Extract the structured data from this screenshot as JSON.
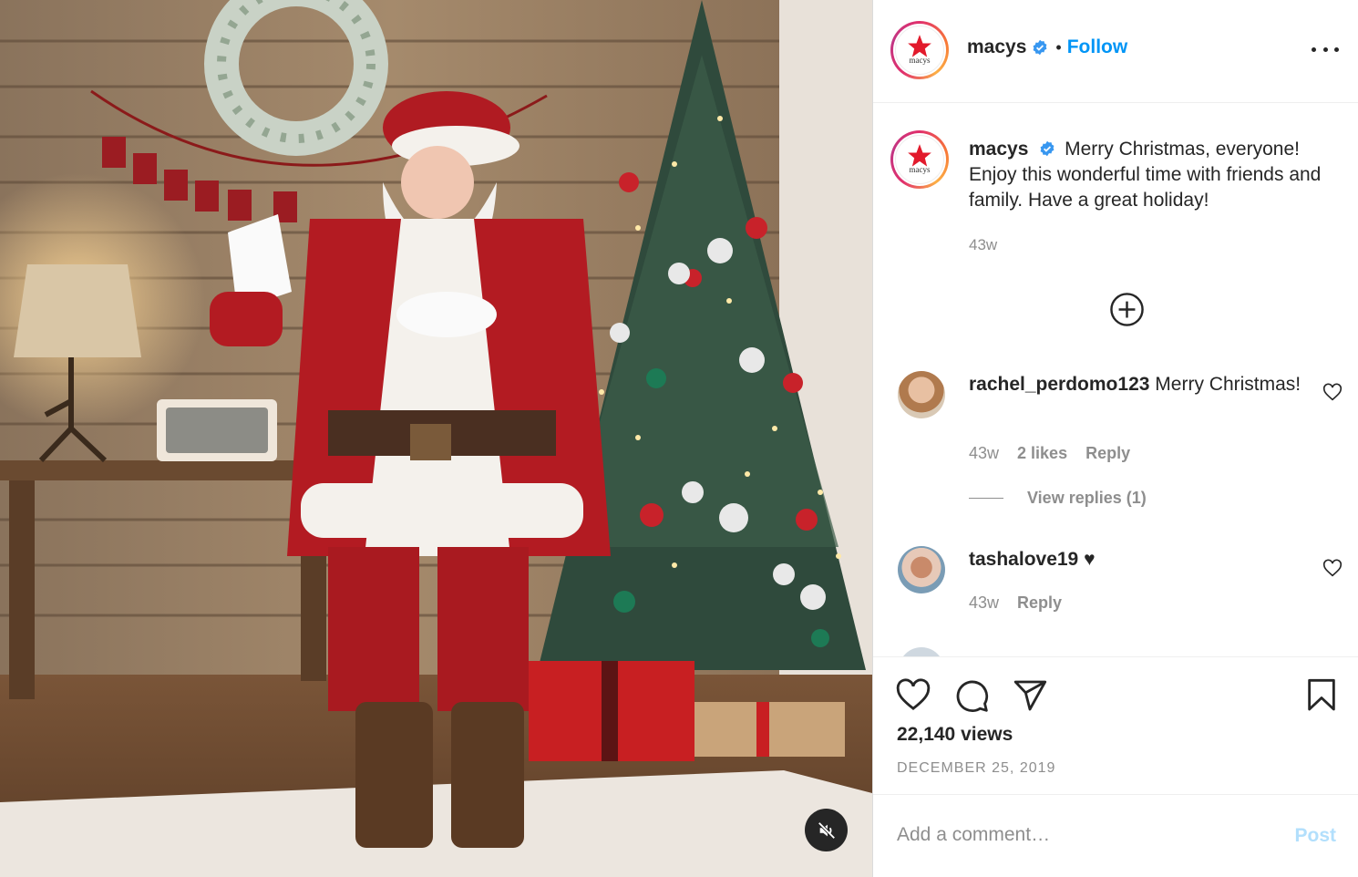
{
  "post": {
    "username": "macys",
    "follow_label": "Follow",
    "separator": "•",
    "avatar_logo_text": "macys",
    "brand_color": "#e21a2c",
    "link_color": "#0095f6"
  },
  "caption": {
    "username": "macys",
    "text": "Merry Christmas, everyone! Enjoy this wonderful time with friends and family. Have a great holiday!",
    "time": "43w"
  },
  "comments": [
    {
      "username": "rachel_perdomo123",
      "text": "Merry Christmas!",
      "time": "43w",
      "likes": "2 likes",
      "reply_label": "Reply",
      "view_replies": "View replies (1)"
    },
    {
      "username": "tashalove19",
      "text": "♥",
      "time": "43w",
      "reply_label": "Reply"
    }
  ],
  "stats": {
    "views": "22,140 views",
    "date": "DECEMBER 25, 2019"
  },
  "add_comment": {
    "placeholder": "Add a comment…",
    "post_label": "Post"
  },
  "icons": {
    "verified": "verified-badge-icon",
    "more": "more-options-icon",
    "load_more": "plus-circle-icon",
    "like": "heart-icon",
    "comment": "comment-bubble-icon",
    "share": "paper-plane-icon",
    "save": "bookmark-icon",
    "mute": "speaker-muted-icon"
  }
}
